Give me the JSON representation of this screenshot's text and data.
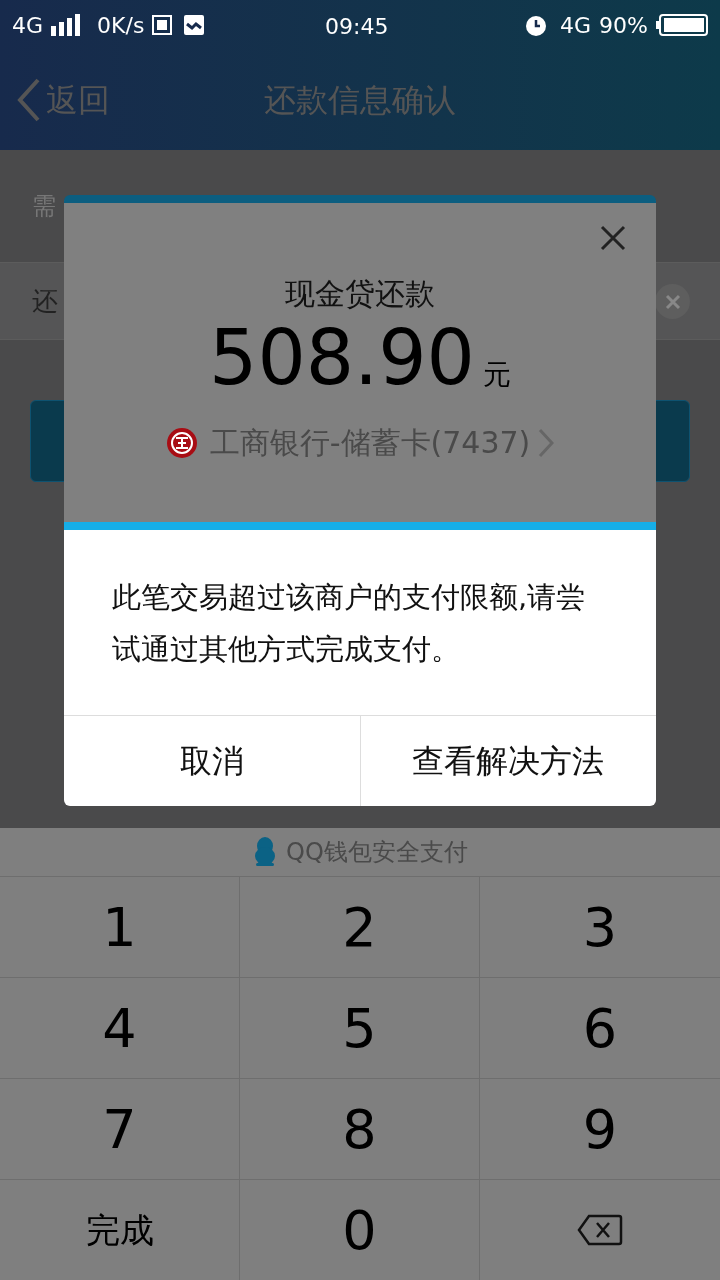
{
  "status_bar": {
    "network": "4G",
    "speed": "0K/s",
    "time": "09:45",
    "network_right": "4G",
    "battery": "90%"
  },
  "nav_bar": {
    "back": "返回",
    "title": "还款信息确认"
  },
  "background_rows": [
    {
      "label": "需"
    },
    {
      "label": "还"
    }
  ],
  "payment_sheet": {
    "title": "现金贷还款",
    "amount": "508.90",
    "unit": "元",
    "card": "工商银行-储蓄卡(7437)"
  },
  "alert": {
    "message": "此笔交易超过该商户的支付限额,请尝试通过其他方式完成支付。",
    "buttons": [
      "取消",
      "查看解决方法"
    ]
  },
  "keypad": {
    "header": "QQ钱包安全支付",
    "keys": [
      {
        "kind": "digit",
        "label": "1"
      },
      {
        "kind": "digit",
        "label": "2"
      },
      {
        "kind": "digit",
        "label": "3"
      },
      {
        "kind": "digit",
        "label": "4"
      },
      {
        "kind": "digit",
        "label": "5"
      },
      {
        "kind": "digit",
        "label": "6"
      },
      {
        "kind": "digit",
        "label": "7"
      },
      {
        "kind": "digit",
        "label": "8"
      },
      {
        "kind": "digit",
        "label": "9"
      },
      {
        "kind": "text",
        "label": "完成"
      },
      {
        "kind": "digit",
        "label": "0"
      },
      {
        "kind": "delete"
      }
    ]
  }
}
